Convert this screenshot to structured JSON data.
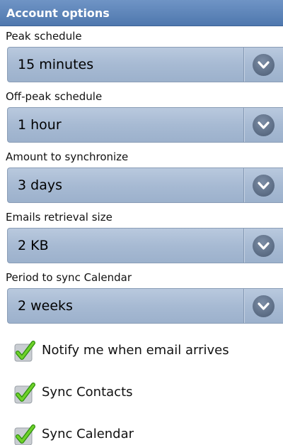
{
  "header": {
    "title": "Account options"
  },
  "settings": [
    {
      "label": "Peak schedule",
      "value": "15 minutes"
    },
    {
      "label": "Off-peak schedule",
      "value": "1 hour"
    },
    {
      "label": "Amount to synchronize",
      "value": "3 days"
    },
    {
      "label": "Emails retrieval size",
      "value": "2 KB"
    },
    {
      "label": "Period to sync Calendar",
      "value": "2 weeks"
    }
  ],
  "checkboxes": [
    {
      "label": "Notify me when email arrives",
      "checked": true
    },
    {
      "label": "Sync Contacts",
      "checked": true
    },
    {
      "label": "Sync Calendar",
      "checked": true
    }
  ],
  "colors": {
    "header": "#5b83b8",
    "spinner": "#a7bad3",
    "check": "#5cc21c"
  },
  "icons": {
    "dropdown": "chevron-down-icon",
    "checkbox": "checkmark-icon"
  }
}
